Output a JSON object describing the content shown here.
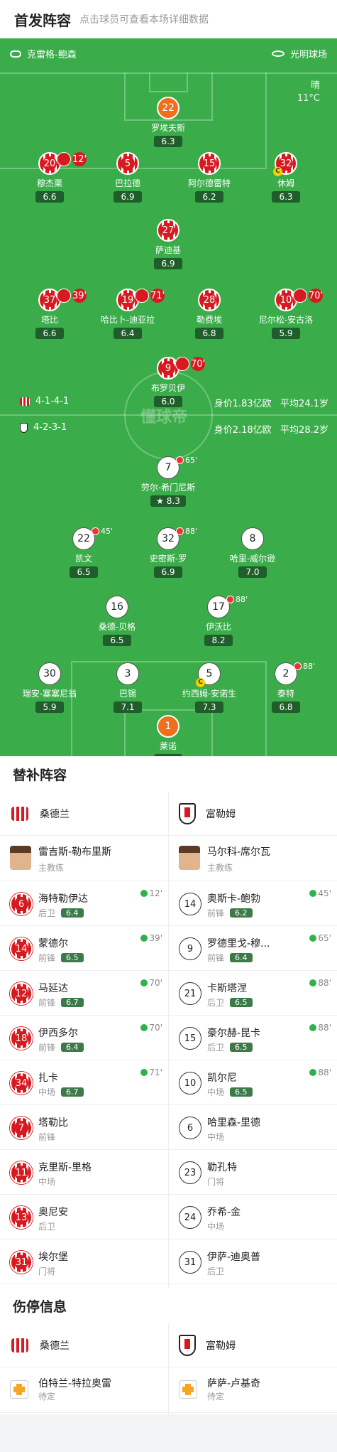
{
  "header": {
    "title": "首发阵容",
    "subtitle": "点击球员可查看本场详细数据"
  },
  "pitch": {
    "coach_icon": "whistle-icon",
    "coach": "克雷格-鲍森",
    "stadium_icon": "stadium-icon",
    "stadium": "光明球场",
    "weather": "晴",
    "temp": "11°C",
    "watermark": "懂球帝",
    "home": {
      "formation": "4-1-4-1",
      "value": "身价1.83亿欧",
      "age": "平均24.1岁"
    },
    "away": {
      "formation": "4-2-3-1",
      "value": "身价2.18亿欧",
      "age": "平均28.2岁"
    },
    "home_players": [
      {
        "num": "22",
        "name": "罗埃夫斯",
        "rating": "6.3"
      },
      {
        "num": "20",
        "name": "穆杰栗",
        "rating": "6.6",
        "ev": "12'"
      },
      {
        "num": "5",
        "name": "巴拉德",
        "rating": "6.9"
      },
      {
        "num": "15",
        "name": "阿尔德雷特",
        "rating": "6.2"
      },
      {
        "num": "32",
        "name": "休姆",
        "rating": "6.3"
      },
      {
        "num": "27",
        "name": "萨迪基",
        "rating": "6.9"
      },
      {
        "num": "37",
        "name": "塔比",
        "rating": "6.6",
        "ev": "39'"
      },
      {
        "num": "19",
        "name": "哈比卜-迪亚拉",
        "rating": "6.4",
        "ev": "71'"
      },
      {
        "num": "28",
        "name": "勒费埃",
        "rating": "6.8"
      },
      {
        "num": "10",
        "name": "尼尔松-安古洛",
        "rating": "5.9",
        "ev": "70'"
      },
      {
        "num": "9",
        "name": "布罗贝伊",
        "rating": "6.0",
        "ev": "70'"
      }
    ],
    "away_players": [
      {
        "num": "7",
        "name": "劳尔-希门尼斯",
        "rating": "8.3",
        "ev": "65'"
      },
      {
        "num": "22",
        "name": "凯文",
        "rating": "6.5",
        "ev": "45'"
      },
      {
        "num": "32",
        "name": "史密斯-罗",
        "rating": "6.9",
        "ev": "88'"
      },
      {
        "num": "8",
        "name": "哈里-威尔逊",
        "rating": "7.0"
      },
      {
        "num": "16",
        "name": "桑德-贝格",
        "rating": "6.5"
      },
      {
        "num": "17",
        "name": "伊沃比",
        "rating": "8.2",
        "ev": "88'"
      },
      {
        "num": "30",
        "name": "瑞安-塞塞尼翁",
        "rating": "5.9"
      },
      {
        "num": "3",
        "name": "巴锡",
        "rating": "7.1"
      },
      {
        "num": "5",
        "name": "约西姆-安诺生",
        "rating": "7.3"
      },
      {
        "num": "2",
        "name": "泰特",
        "rating": "6.8",
        "ev": "88'"
      },
      {
        "num": "1",
        "name": "莱诺",
        "rating": "6.4"
      }
    ]
  },
  "subs": {
    "title": "替补阵容",
    "home_team": "桑德兰",
    "away_team": "富勒姆",
    "home_coach": {
      "name": "雷吉斯-勒布里斯",
      "role": "主教练"
    },
    "away_coach": {
      "name": "马尔科-席尔瓦",
      "role": "主教练"
    },
    "home": [
      {
        "num": "6",
        "name": "海特勒伊达",
        "pos": "后卫",
        "rating": "6.4",
        "time": "12'"
      },
      {
        "num": "14",
        "name": "蒙德尔",
        "pos": "前锋",
        "rating": "6.5",
        "time": "39'"
      },
      {
        "num": "12",
        "name": "马延达",
        "pos": "前锋",
        "rating": "6.7",
        "time": "70'"
      },
      {
        "num": "18",
        "name": "伊西多尔",
        "pos": "前锋",
        "rating": "6.4",
        "time": "70'"
      },
      {
        "num": "34",
        "name": "扎卡",
        "pos": "中场",
        "rating": "6.7",
        "time": "71'"
      },
      {
        "num": "7",
        "name": "塔勒比",
        "pos": "前锋"
      },
      {
        "num": "11",
        "name": "克里斯-里格",
        "pos": "中场"
      },
      {
        "num": "13",
        "name": "奥尼安",
        "pos": "后卫"
      },
      {
        "num": "31",
        "name": "埃尔堡",
        "pos": "门将"
      }
    ],
    "away": [
      {
        "num": "14",
        "name": "奥斯卡-鲍勃",
        "pos": "前锋",
        "rating": "6.2",
        "time": "45'"
      },
      {
        "num": "9",
        "name": "罗德里戈-穆...",
        "pos": "前锋",
        "rating": "6.4",
        "time": "65'"
      },
      {
        "num": "21",
        "name": "卡斯塔涅",
        "pos": "后卫",
        "rating": "6.5",
        "time": "88'"
      },
      {
        "num": "15",
        "name": "豪尔赫-昆卡",
        "pos": "后卫",
        "rating": "6.5",
        "time": "88'"
      },
      {
        "num": "10",
        "name": "凯尔尼",
        "pos": "中场",
        "rating": "6.5",
        "time": "88'"
      },
      {
        "num": "6",
        "name": "哈里森-里德",
        "pos": "中场"
      },
      {
        "num": "23",
        "name": "勒孔特",
        "pos": "门将"
      },
      {
        "num": "24",
        "name": "乔希-金",
        "pos": "中场"
      },
      {
        "num": "31",
        "name": "伊萨-迪奥普",
        "pos": "后卫"
      }
    ]
  },
  "injury": {
    "title": "伤停信息",
    "home_team": "桑德兰",
    "away_team": "富勒姆",
    "home": {
      "name": "伯特兰-特拉奥雷",
      "status": "待定"
    },
    "away": {
      "name": "萨萨-卢基奇",
      "status": "待定"
    }
  }
}
